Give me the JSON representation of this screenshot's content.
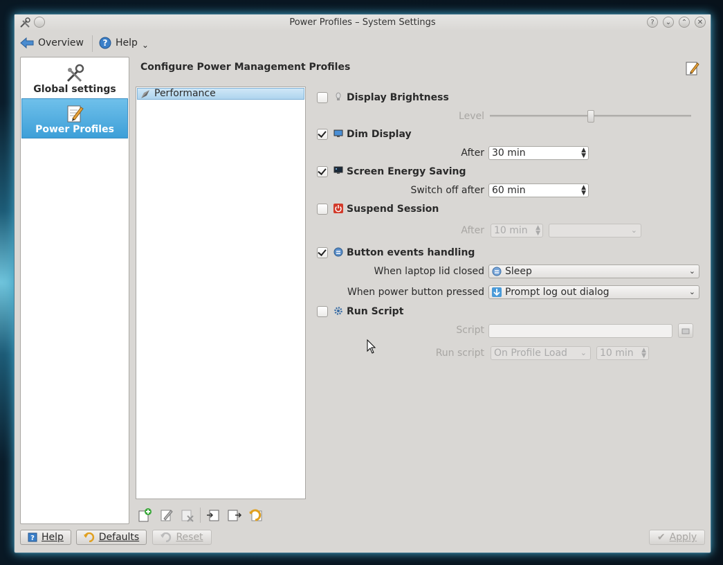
{
  "window": {
    "title": "Power Profiles – System Settings"
  },
  "toolbar": {
    "overview_label": "Overview",
    "help_label": "Help",
    "help_menu_glyph": "⌄"
  },
  "sidebar": {
    "items": [
      {
        "label": "Global settings",
        "icon": "tools-icon"
      },
      {
        "label": "Power Profiles",
        "icon": "pencil-note-icon",
        "selected": true
      }
    ]
  },
  "main": {
    "heading": "Configure Power Management Profiles",
    "profiles": [
      {
        "label": "Performance",
        "selected": true
      }
    ],
    "sections": {
      "display_brightness": {
        "label": "Display Brightness",
        "checked": false,
        "level_label": "Level",
        "level_fraction": 0.5
      },
      "dim_display": {
        "label": "Dim Display",
        "checked": true,
        "after_label": "After",
        "after_value": "30 min"
      },
      "screen_energy": {
        "label": "Screen Energy Saving",
        "checked": true,
        "switch_off_label": "Switch off after",
        "switch_off_value": "60 min"
      },
      "suspend": {
        "label": "Suspend Session",
        "checked": false,
        "after_label": "After",
        "after_value": "10 min",
        "action_value": ""
      },
      "button_events": {
        "label": "Button events handling",
        "checked": true,
        "lid_label": "When laptop lid closed",
        "lid_value": "Sleep",
        "power_label": "When power button pressed",
        "power_value": "Prompt log out dialog"
      },
      "run_script": {
        "label": "Run Script",
        "checked": false,
        "script_label": "Script",
        "script_value": "",
        "run_label": "Run script",
        "run_value": "On Profile Load",
        "run_time": "10 min"
      }
    }
  },
  "bottom": {
    "help_label": "Help",
    "defaults_label": "Defaults",
    "reset_label": "Reset",
    "apply_label": "Apply"
  },
  "colors": {
    "accent": "#3d9fd8",
    "selection": "#aed4ee",
    "window_bg": "#d9d7d4"
  }
}
